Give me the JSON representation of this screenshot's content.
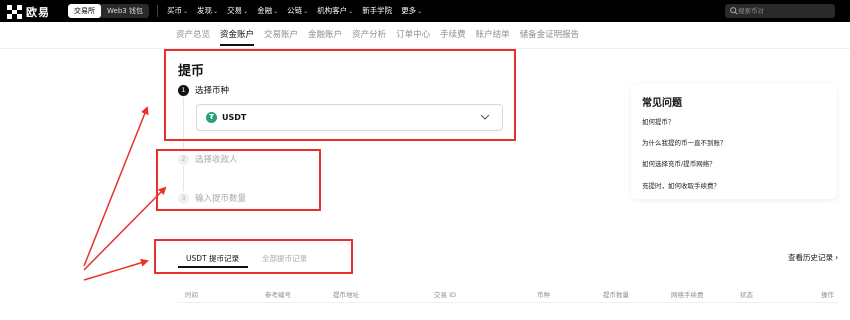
{
  "topbar": {
    "logo_text": "欧易",
    "mode_tabs": [
      "交易所",
      "Web3 钱包"
    ],
    "menu": [
      {
        "label": "买币",
        "caret": true
      },
      {
        "label": "发现",
        "caret": true
      },
      {
        "label": "交易",
        "caret": true
      },
      {
        "label": "金融",
        "caret": true
      },
      {
        "label": "公链",
        "caret": true
      },
      {
        "label": "机构客户",
        "caret": true
      },
      {
        "label": "新手学院",
        "caret": false
      },
      {
        "label": "更多",
        "caret": true
      }
    ],
    "search_placeholder": "搜索币对"
  },
  "subnav": {
    "items": [
      "资产总览",
      "资金账户",
      "交易账户",
      "金融账户",
      "资产分析",
      "订单中心",
      "手续费",
      "账户结单",
      "储备金证明报告"
    ],
    "active_index": 1
  },
  "withdraw": {
    "title": "提币",
    "steps": [
      {
        "num": "1",
        "label": "选择币种"
      },
      {
        "num": "2",
        "label": "选择收款人"
      },
      {
        "num": "3",
        "label": "输入提币数量"
      }
    ],
    "coin": {
      "icon_glyph": "₮",
      "symbol": "USDT"
    }
  },
  "faq": {
    "title": "常见问题",
    "questions": [
      "如何提币？",
      "为什么我提的币一直不到账？",
      "如何选择充币/提币网络？",
      "充提时，如何收取手续费？"
    ]
  },
  "history": {
    "tabs": [
      "USDT 提币记录",
      "全部提币记录"
    ],
    "view_all": "查看历史记录",
    "columns": [
      "时间",
      "参考编号",
      "提币地址",
      "交易 ID",
      "币种",
      "提币数量",
      "网络手续费",
      "状态",
      "操作"
    ]
  },
  "colors": {
    "annotation": "#e8312a",
    "usdt": "#26a17b",
    "topbar": "#000000"
  }
}
